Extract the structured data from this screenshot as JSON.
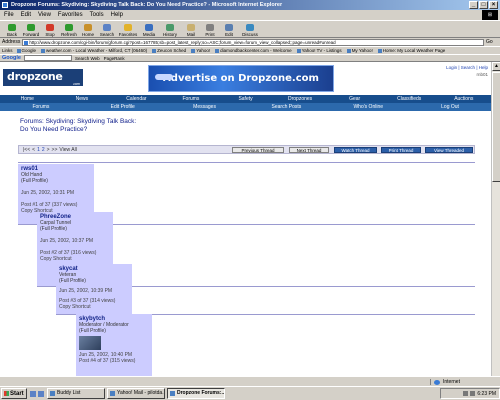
{
  "window": {
    "title": "Dropzone Forums: Skydiving: Skydiving Talk Back: Do You Need Practice? - Microsoft Internet Explorer"
  },
  "menu": [
    "File",
    "Edit",
    "View",
    "Favorites",
    "Tools",
    "Help"
  ],
  "toolbar": [
    {
      "label": "Back",
      "icon": "back-arrow-icon",
      "color": "#2e9a2e"
    },
    {
      "label": "Forward",
      "icon": "forward-arrow-icon",
      "color": "#2e9a2e"
    },
    {
      "label": "Stop",
      "icon": "stop-icon",
      "color": "#d23a2a"
    },
    {
      "label": "Refresh",
      "icon": "refresh-icon",
      "color": "#2e9a2e"
    },
    {
      "label": "Home",
      "icon": "home-icon",
      "color": "#c8902a"
    },
    {
      "label": "Search",
      "icon": "search-icon",
      "color": "#5b82c6"
    },
    {
      "label": "Favorites",
      "icon": "favorites-icon",
      "color": "#e2b22a"
    },
    {
      "label": "Media",
      "icon": "media-icon",
      "color": "#3a6fc0"
    },
    {
      "label": "History",
      "icon": "history-icon",
      "color": "#4a9a6a"
    },
    {
      "label": "Mail",
      "icon": "mail-icon",
      "color": "#c8b070"
    },
    {
      "label": "Print",
      "icon": "print-icon",
      "color": "#808080"
    },
    {
      "label": "Edit",
      "icon": "edit-icon",
      "color": "#5a7fb0"
    },
    {
      "label": "Discuss",
      "icon": "discuss-icon",
      "color": "#3a8ac0"
    }
  ],
  "address": {
    "label": "Address",
    "url": "http://www.dropzone.com/cgi-bin/forum/gforum.cgi?post=167785;sb=post_latest_reply;so=ASC;forum_view=forum_view_collapsed;;page=unread#unread",
    "go": "Go"
  },
  "links": {
    "label": "Links",
    "items": [
      "Google",
      "weather.com - Local Weather - Milford, CT (06460)",
      "Zeucon Sched",
      "Yahoo!",
      "diamondbackcenter.com - Welcome",
      "Yahoo! TV - Listings",
      "My Yahoo!",
      "Home: My Local Weather Page"
    ]
  },
  "googlebar": {
    "logo": "Google",
    "search_label": "Search Web",
    "pagerank": "PageRank"
  },
  "site": {
    "logo": "dropzone",
    "logo_sub": ".com",
    "banner": "Advertise on Dropzone.com",
    "head_links": "Login | Search | Help",
    "user": "rnb01"
  },
  "nav_main": [
    "Home",
    "News",
    "Calendar",
    "Forums",
    "Safety",
    "Dropzones",
    "Gear",
    "Classifieds",
    "Auctions"
  ],
  "nav_sub": [
    "Forums",
    "Edit Profile",
    "Messages",
    "Search Posts",
    "Who's Online",
    "Log Out"
  ],
  "forum": {
    "line1": "Forums: Skydiving: Skydiving Talk Back:",
    "line2": "Do You Need Practice?"
  },
  "thread_bar": {
    "first": "|<<",
    "prev": "<",
    "pages": [
      "1",
      "2"
    ],
    "next": ">",
    "last": ">>",
    "view_all": "View All",
    "buttons": [
      "Previous Thread",
      "Next Thread",
      "Watch Thread",
      "Print Thread",
      "View Threaded"
    ]
  },
  "posts": [
    {
      "user": "rws01",
      "rank": "Old Hand",
      "profile": "(Full Profile)",
      "date": "Jun 25, 2002, 10:31 PM",
      "count": "Post #1 of 37 (337 views)",
      "copy": "Copy Shortcut"
    },
    {
      "user": "PhreeZone",
      "rank": "Carpal Tunnel",
      "profile": "(Full Profile)",
      "date": "Jun 25, 2002, 10:37 PM",
      "count": "Post #2 of 37 (316 views)",
      "copy": "Copy Shortcut"
    },
    {
      "user": "skycat",
      "rank": "Veteran",
      "profile": "(Full Profile)",
      "date": "Jun 25, 2002, 10:39 PM",
      "count": "Post #3 of 37 (314 views)",
      "copy": "Copy Shortcut"
    },
    {
      "user": "skybytch",
      "rank": "Moderator / Moderator",
      "profile": "(Full Profile)",
      "date": "Jun 25, 2002, 10:40 PM",
      "count": "Post #4 of 37 (315 views)",
      "copy": ""
    }
  ],
  "status": {
    "main": "",
    "zone": "Internet"
  },
  "taskbar": {
    "start": "Start",
    "tasks": [
      "Buddy List",
      "Yahoo! Mail - pilotda...",
      "Dropzone Forums:..."
    ],
    "clock": "6:23 PM"
  }
}
